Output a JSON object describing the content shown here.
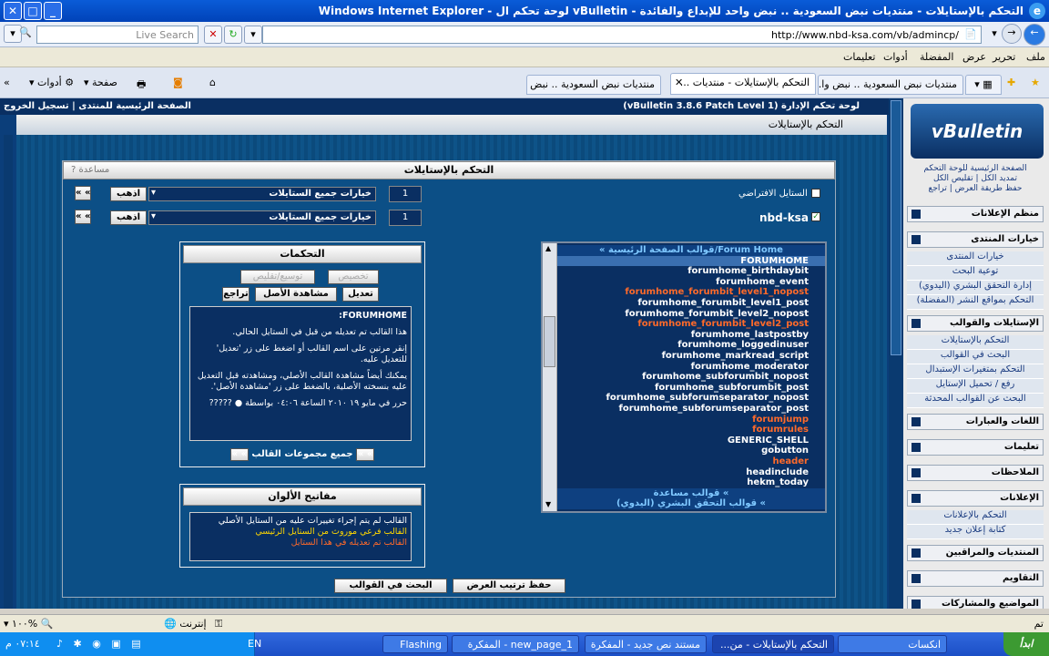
{
  "window": {
    "title": "التحكم بالإستايلات - منتديات نبض السعودية .. نبض واحد للإبداع والفائدة - vBulletin لوحة تحكم ال - Windows Internet Explorer"
  },
  "toolbar": {
    "address": "http://www.nbd-ksa.com/vb/admincp/",
    "search_placeholder": "Live Search"
  },
  "menu": [
    "ملف",
    "تحرير",
    "عرض",
    "المفضلة",
    "أدوات",
    "تعليمات"
  ],
  "command_bar": {
    "page_label": "صفحة",
    "tools_label": "أدوات"
  },
  "tabs": [
    "منتديات نبض السعودية .. نبض وا...",
    "التحكم بالإستايلات - منتديات ...",
    "منتديات نبض السعودية .. نبض وا...",
    "منتديات نبض السعودية .. نبض وا..."
  ],
  "header": {
    "left_links": "الصفحة الرئيسية للمنتدى | تسجيل الخروج",
    "right_title": "لوحة تحكم الإدارة (vBulletin 3.8.6 Patch Level 1)"
  },
  "breadcrumb": "التحكم بالإستايلات",
  "main_panel": {
    "title": "التحكم بالإستايلات",
    "help": "مساعدة",
    "style_rows": [
      {
        "name": "الستايل الافتراضي",
        "order": "1",
        "select": "خيارات جميع الستايلات",
        "go": "اذهب",
        "arrows": "«"
      },
      {
        "name": "nbd-ksa",
        "order": "1",
        "select": "خيارات جميع الستايلات",
        "go": "اذهب",
        "arrows": "«"
      }
    ]
  },
  "template_list": {
    "items": [
      {
        "text": "« قوالب الصفحة الرئيسية/Forum Home",
        "kind": "grp"
      },
      {
        "text": "FORUMHOME",
        "kind": "sel"
      },
      {
        "text": "forumhome_birthdaybit",
        "kind": "norm"
      },
      {
        "text": "forumhome_event",
        "kind": "norm"
      },
      {
        "text": "forumhome_forumbit_level1_nopost",
        "kind": "red"
      },
      {
        "text": "forumhome_forumbit_level1_post",
        "kind": "norm"
      },
      {
        "text": "forumhome_forumbit_level2_nopost",
        "kind": "norm"
      },
      {
        "text": "forumhome_forumbit_level2_post",
        "kind": "red"
      },
      {
        "text": "forumhome_lastpostby",
        "kind": "norm"
      },
      {
        "text": "forumhome_loggedinuser",
        "kind": "norm"
      },
      {
        "text": "forumhome_markread_script",
        "kind": "norm"
      },
      {
        "text": "forumhome_moderator",
        "kind": "norm"
      },
      {
        "text": "forumhome_subforumbit_nopost",
        "kind": "norm"
      },
      {
        "text": "forumhome_subforumbit_post",
        "kind": "norm"
      },
      {
        "text": "forumhome_subforumseparator_nopost",
        "kind": "norm"
      },
      {
        "text": "forumhome_subforumseparator_post",
        "kind": "norm"
      },
      {
        "text": "forumjump",
        "kind": "red"
      },
      {
        "text": "forumrules",
        "kind": "red"
      },
      {
        "text": "GENERIC_SHELL",
        "kind": "norm"
      },
      {
        "text": "gobutton",
        "kind": "norm"
      },
      {
        "text": "header",
        "kind": "red"
      },
      {
        "text": "headinclude",
        "kind": "norm"
      },
      {
        "text": "hekm_today",
        "kind": "norm"
      },
      {
        "text": "قوالب مساعدة «",
        "kind": "grp"
      },
      {
        "text": "قوالب التحقق البشري (اليدوي) «",
        "kind": "grp"
      }
    ]
  },
  "controls_panel": {
    "title": "التحكمات",
    "btn_customize": "تخصيص",
    "btn_expand": "توسيع/تقليص",
    "btn_edit": "تعديل",
    "btn_view_original": "مشاهدة الأصل",
    "btn_revert": "تراجع",
    "info_title": "FORUMHOME:",
    "info_p1": "هذا القالب تم تعديله من قبل في الستايل الحالي.",
    "info_p2": "إنقر مرتين على اسم القالب أو اضغط على زر 'تعديل' للتعديل عليه.",
    "info_p3": "يمكنك أيضاً مشاهدة القالب الأصلي، ومشاهدته قبل التعديل عليه بنسخته الأصلية، بالضغط على زر 'مشاهدة الأصل'.",
    "info_footer": "حرر في مايو ١٩ ٢٠١٠ الساعة ٠٤:٠٦ بواسطة ● ?????",
    "expand_groups": "جميع مجموعات القالب"
  },
  "color_key": {
    "title": "مفاتيح الألوان",
    "line1": "القالب لم يتم إجراء تغييرات عليه من الستايل الأصلي",
    "line2": "القالب فرعي موروث من الستايل الرئيسي",
    "line3": "القالب تم تعديله في هذا الستايل",
    "colors": {
      "line1": "#ffffff",
      "line2": "#ffd700",
      "line3": "#ff6a2a"
    }
  },
  "bottom_buttons": {
    "save": "حفظ ترتيب العرض",
    "search": "البحث في القوالب"
  },
  "sidebar": {
    "links": "الصفحة الرئيسية للوحة التحكم\nتمديد الكل | تقليص الكل\nحفظ طريقة العرض | تراجع",
    "sections": [
      {
        "title": "منظم الإعلانات",
        "items": []
      },
      {
        "title": "خيارات المنتدى",
        "items": [
          "خيارات المنتدى",
          "توعية البحث",
          "إدارة التحقق البشري (اليدوي)",
          "التحكم بمواقع النشر (المفضلة)"
        ]
      },
      {
        "title": "الإستايلات والقوالب",
        "items": [
          "التحكم بالإستايلات",
          "البحث في القوالب",
          "التحكم بمتغيرات الإستبدال",
          "رفع / تحميل الإستايل",
          "البحث عن القوالب المحدثة"
        ]
      },
      {
        "title": "اللغات والعبارات",
        "items": []
      },
      {
        "title": "تعليمات",
        "items": []
      },
      {
        "title": "الملاحظات",
        "items": []
      },
      {
        "title": "الإعلانات",
        "items": [
          "التحكم بالإعلانات",
          "كتابة إعلان جديد"
        ]
      },
      {
        "title": "المنتديات والمراقبين",
        "items": []
      },
      {
        "title": "التقاويم",
        "items": []
      },
      {
        "title": "المواضيع والمشاركات",
        "items": []
      }
    ]
  },
  "statusbar": {
    "done": "تم",
    "zone": "إنترنت",
    "zoom": "١٠٠%"
  },
  "taskbar": {
    "start": "ابدأ",
    "tasks": [
      "انكسات",
      "التحكم بالإستايلات - من...",
      "مستند نص جديد - المفكرة",
      "new_page_1 - المفكرة",
      "Flashing"
    ],
    "lang": "EN",
    "clock": "٠٧:١٤ م"
  }
}
